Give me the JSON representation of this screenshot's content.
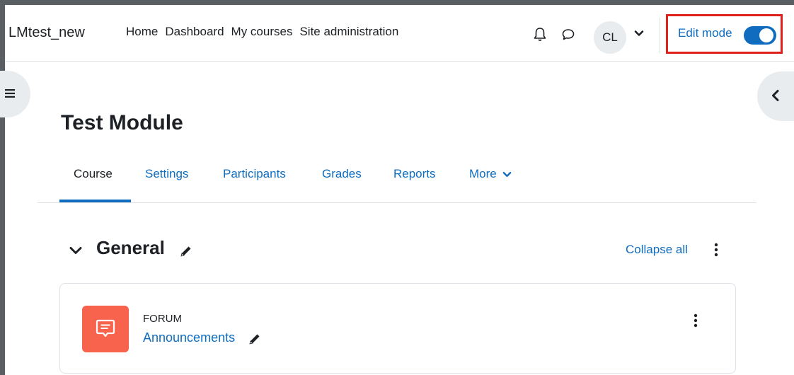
{
  "site": {
    "name": "LMtest_new"
  },
  "primary_nav": [
    "Home",
    "Dashboard",
    "My courses",
    "Site administration"
  ],
  "user": {
    "initials": "CL"
  },
  "edit_mode": {
    "label": "Edit mode",
    "enabled": true
  },
  "course": {
    "title": "Test Module"
  },
  "secondary_nav": {
    "tabs": [
      "Course",
      "Settings",
      "Participants",
      "Grades",
      "Reports",
      "More"
    ],
    "active": "Course"
  },
  "section": {
    "title": "General",
    "collapse_label": "Collapse all"
  },
  "activity": {
    "type_label": "FORUM",
    "name": "Announcements"
  },
  "colors": {
    "accent": "#0f6cbf",
    "forum_icon_bg": "#f7634d",
    "highlight_border": "#e0201a"
  },
  "icons": [
    "bell-icon",
    "chat-icon",
    "chevron-down-icon",
    "hamburger-icon",
    "chevron-left-icon",
    "pencil-icon",
    "kebab-icon",
    "forum-icon"
  ]
}
